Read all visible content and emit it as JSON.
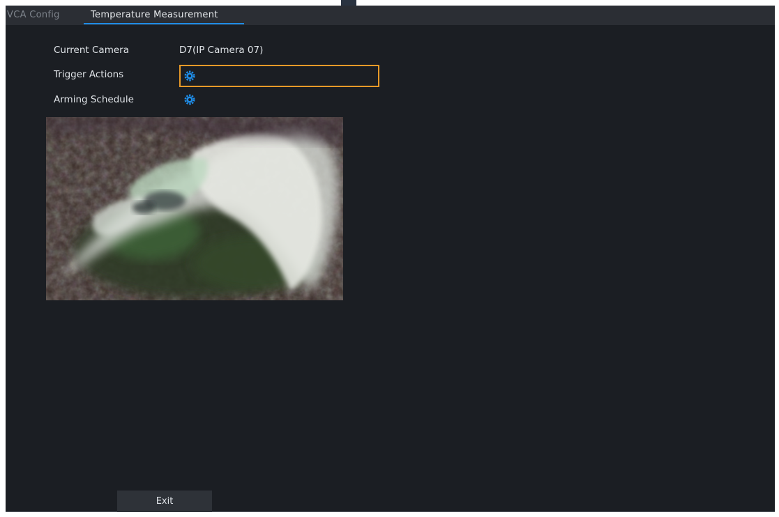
{
  "tabs": [
    {
      "label": "VCA Config"
    },
    {
      "label": "Temperature Measurement"
    }
  ],
  "fields": {
    "current_camera": {
      "label": "Current Camera",
      "value": "D7(IP Camera 07)"
    },
    "trigger_actions": {
      "label": "Trigger Actions",
      "icon": "gear-icon"
    },
    "arming_schedule": {
      "label": "Arming Schedule",
      "icon": "gear-icon"
    }
  },
  "footer": {
    "exit_label": "Exit"
  },
  "colors": {
    "accent": "#1f8ce6",
    "focus_border": "#e89a28",
    "background": "#1b1e23",
    "tab_bar": "#2b2e34"
  }
}
